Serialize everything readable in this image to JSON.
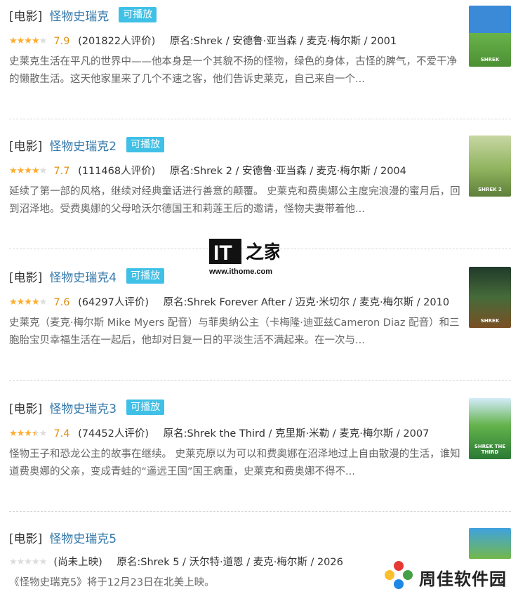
{
  "results": [
    {
      "category": "[电影]",
      "title": "怪物史瑞克",
      "playable": "可播放",
      "stars": 4,
      "half": false,
      "rating": "7.9",
      "votes": "(201822人评价)",
      "original": "原名:Shrek / 安德鲁·亚当森 / 麦克·梅尔斯 / 2001",
      "summary": "史莱克生活在平凡的世界中——他本身是一个其貌不扬的怪物，绿色的身体，古怪的脾气，不爱干净的懒散生活。这天他家里来了几个不速之客，他们告诉史莱克，自己来自一个...",
      "poster_colors": [
        "#6ab04c",
        "#2e86de"
      ],
      "poster_label": "SHREK"
    },
    {
      "category": "[电影]",
      "title": "怪物史瑞克2",
      "playable": "可播放",
      "stars": 4,
      "half": false,
      "rating": "7.7",
      "votes": "(111468人评价)",
      "original": "原名:Shrek 2 / 安德鲁·亚当森 / 麦克·梅尔斯 / 2004",
      "summary": "延续了第一部的风格，继续对经典童话进行善意的颠覆。 史莱克和费奥娜公主度完浪漫的蜜月后，回到沼泽地。受费奥娜的父母哈沃尔德国王和莉莲王后的邀请，怪物夫妻带着他...",
      "poster_colors": [
        "#9fbf7a",
        "#d8d0a8"
      ],
      "poster_label": "SHREK 2"
    },
    {
      "category": "[电影]",
      "title": "怪物史瑞克4",
      "playable": "可播放",
      "stars": 4,
      "half": false,
      "rating": "7.6",
      "votes": "(64297人评价)",
      "original": "原名:Shrek Forever After / 迈克·米切尔 / 麦克·梅尔斯 / 2010",
      "summary": "史莱克（麦克·梅尔斯 Mike Myers 配音）与菲奥纳公主（卡梅隆·迪亚兹Cameron Diaz 配音）和三胞胎宝贝幸福生活在一起后，他却对日复一日的平淡生活不满起来。在一次与...",
      "poster_colors": [
        "#1e3d2f",
        "#8a5a2b"
      ],
      "poster_label": "SHREK"
    },
    {
      "category": "[电影]",
      "title": "怪物史瑞克3",
      "playable": "可播放",
      "stars": 3,
      "half": true,
      "rating": "7.4",
      "votes": "(74452人评价)",
      "original": "原名:Shrek the Third / 克里斯·米勒 / 麦克·梅尔斯 / 2007",
      "summary": "怪物王子和恐龙公主的故事在继续。 史莱克原以为可以和费奥娜在沼泽地过上自由散漫的生活，谁知道费奥娜的父亲，变成青蛙的“遥远王国”国王病重，史莱克和费奥娜不得不...",
      "poster_colors": [
        "#2e8b3e",
        "#cfe8f6"
      ],
      "poster_label": "SHREK THE THIRD"
    },
    {
      "category": "[电影]",
      "title": "怪物史瑞克5",
      "playable": "",
      "stars": 0,
      "half": false,
      "rating": "",
      "votes": "(尚未上映)",
      "original": "原名:Shrek 5 / 沃尔特·道恩 / 麦克·梅尔斯 / 2026",
      "summary": "《怪物史瑞克5》将于12月23日在北美上映。",
      "poster_colors": [
        "#3fa2df",
        "#74b84a"
      ],
      "poster_label": ""
    }
  ],
  "watermarks": {
    "ithome_url": "www.ithome.com",
    "zj_name": "周佳软件园"
  }
}
